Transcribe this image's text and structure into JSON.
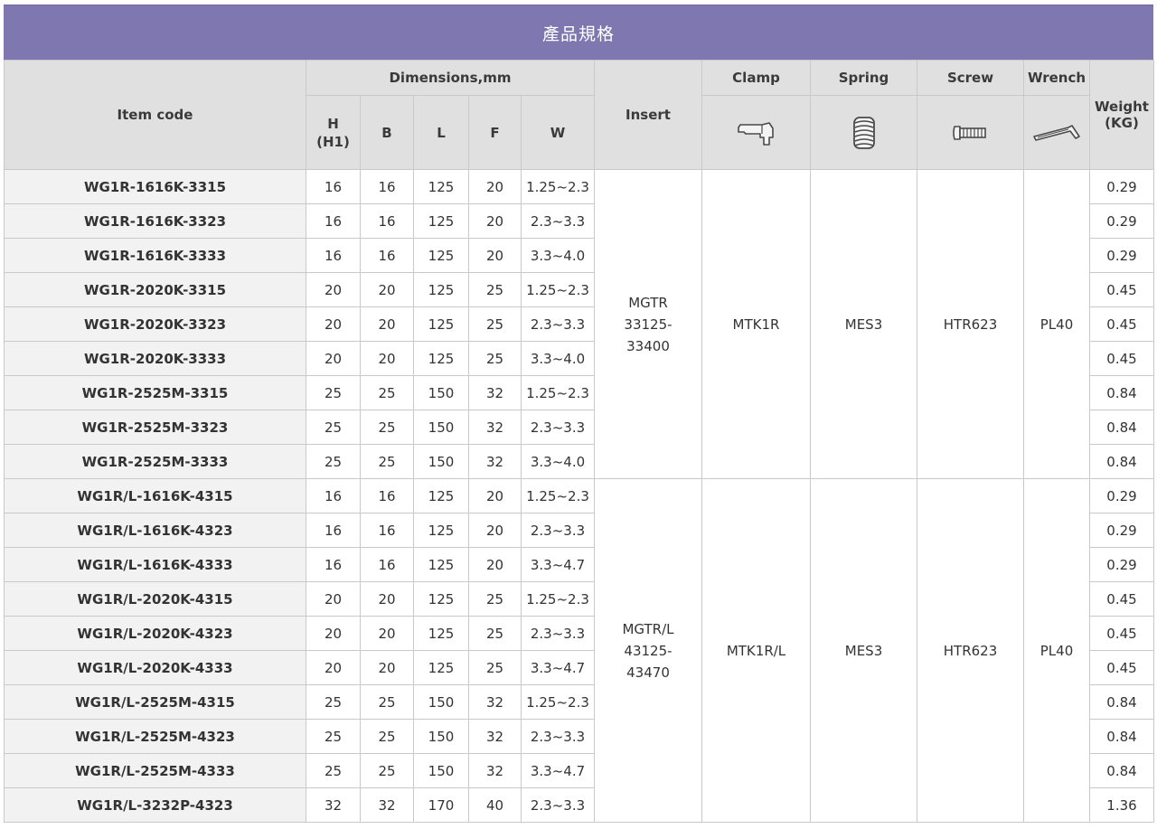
{
  "title": "產品規格",
  "headers": {
    "item_code": "Item code",
    "dimensions": "Dimensions,mm",
    "dim_h": "H",
    "dim_h1": "(H1)",
    "dim_b": "B",
    "dim_l": "L",
    "dim_f": "F",
    "dim_w": "W",
    "insert": "Insert",
    "clamp": "Clamp",
    "spring": "Spring",
    "screw": "Screw",
    "wrench": "Wrench",
    "weight": "Weight",
    "weight_unit": "(KG)"
  },
  "icons": {
    "clamp": "clamp-icon",
    "spring": "spring-icon",
    "screw": "screw-icon",
    "wrench": "hex-wrench-icon"
  },
  "groups": [
    {
      "insert": [
        "MGTR",
        "33125-",
        "33400"
      ],
      "clamp": "MTK1R",
      "spring": "MES3",
      "screw": "HTR623",
      "wrench": "PL40",
      "rows": [
        {
          "code": "WG1R-1616K-3315",
          "h": "16",
          "b": "16",
          "l": "125",
          "f": "20",
          "w": "1.25~2.3",
          "weight": "0.29"
        },
        {
          "code": "WG1R-1616K-3323",
          "h": "16",
          "b": "16",
          "l": "125",
          "f": "20",
          "w": "2.3~3.3",
          "weight": "0.29"
        },
        {
          "code": "WG1R-1616K-3333",
          "h": "16",
          "b": "16",
          "l": "125",
          "f": "20",
          "w": "3.3~4.0",
          "weight": "0.29"
        },
        {
          "code": "WG1R-2020K-3315",
          "h": "20",
          "b": "20",
          "l": "125",
          "f": "25",
          "w": "1.25~2.3",
          "weight": "0.45"
        },
        {
          "code": "WG1R-2020K-3323",
          "h": "20",
          "b": "20",
          "l": "125",
          "f": "25",
          "w": "2.3~3.3",
          "weight": "0.45"
        },
        {
          "code": "WG1R-2020K-3333",
          "h": "20",
          "b": "20",
          "l": "125",
          "f": "25",
          "w": "3.3~4.0",
          "weight": "0.45"
        },
        {
          "code": "WG1R-2525M-3315",
          "h": "25",
          "b": "25",
          "l": "150",
          "f": "32",
          "w": "1.25~2.3",
          "weight": "0.84"
        },
        {
          "code": "WG1R-2525M-3323",
          "h": "25",
          "b": "25",
          "l": "150",
          "f": "32",
          "w": "2.3~3.3",
          "weight": "0.84"
        },
        {
          "code": "WG1R-2525M-3333",
          "h": "25",
          "b": "25",
          "l": "150",
          "f": "32",
          "w": "3.3~4.0",
          "weight": "0.84"
        }
      ]
    },
    {
      "insert": [
        "MGTR/L",
        "43125-",
        "43470"
      ],
      "clamp": "MTK1R/L",
      "spring": "MES3",
      "screw": "HTR623",
      "wrench": "PL40",
      "rows": [
        {
          "code": "WG1R/L-1616K-4315",
          "h": "16",
          "b": "16",
          "l": "125",
          "f": "20",
          "w": "1.25~2.3",
          "weight": "0.29"
        },
        {
          "code": "WG1R/L-1616K-4323",
          "h": "16",
          "b": "16",
          "l": "125",
          "f": "20",
          "w": "2.3~3.3",
          "weight": "0.29"
        },
        {
          "code": "WG1R/L-1616K-4333",
          "h": "16",
          "b": "16",
          "l": "125",
          "f": "20",
          "w": "3.3~4.7",
          "weight": "0.29"
        },
        {
          "code": "WG1R/L-2020K-4315",
          "h": "20",
          "b": "20",
          "l": "125",
          "f": "25",
          "w": "1.25~2.3",
          "weight": "0.45"
        },
        {
          "code": "WG1R/L-2020K-4323",
          "h": "20",
          "b": "20",
          "l": "125",
          "f": "25",
          "w": "2.3~3.3",
          "weight": "0.45"
        },
        {
          "code": "WG1R/L-2020K-4333",
          "h": "20",
          "b": "20",
          "l": "125",
          "f": "25",
          "w": "3.3~4.7",
          "weight": "0.45"
        },
        {
          "code": "WG1R/L-2525M-4315",
          "h": "25",
          "b": "25",
          "l": "150",
          "f": "32",
          "w": "1.25~2.3",
          "weight": "0.84"
        },
        {
          "code": "WG1R/L-2525M-4323",
          "h": "25",
          "b": "25",
          "l": "150",
          "f": "32",
          "w": "2.3~3.3",
          "weight": "0.84"
        },
        {
          "code": "WG1R/L-2525M-4333",
          "h": "25",
          "b": "25",
          "l": "150",
          "f": "32",
          "w": "3.3~4.7",
          "weight": "0.84"
        },
        {
          "code": "WG1R/L-3232P-4323",
          "h": "32",
          "b": "32",
          "l": "170",
          "f": "40",
          "w": "2.3~3.3",
          "weight": "1.36"
        }
      ]
    }
  ],
  "colors": {
    "banner": "#7e77b0",
    "header_bg": "#e0e0e0",
    "code_bg": "#f2f2f2",
    "border": "#c9c9c9"
  }
}
